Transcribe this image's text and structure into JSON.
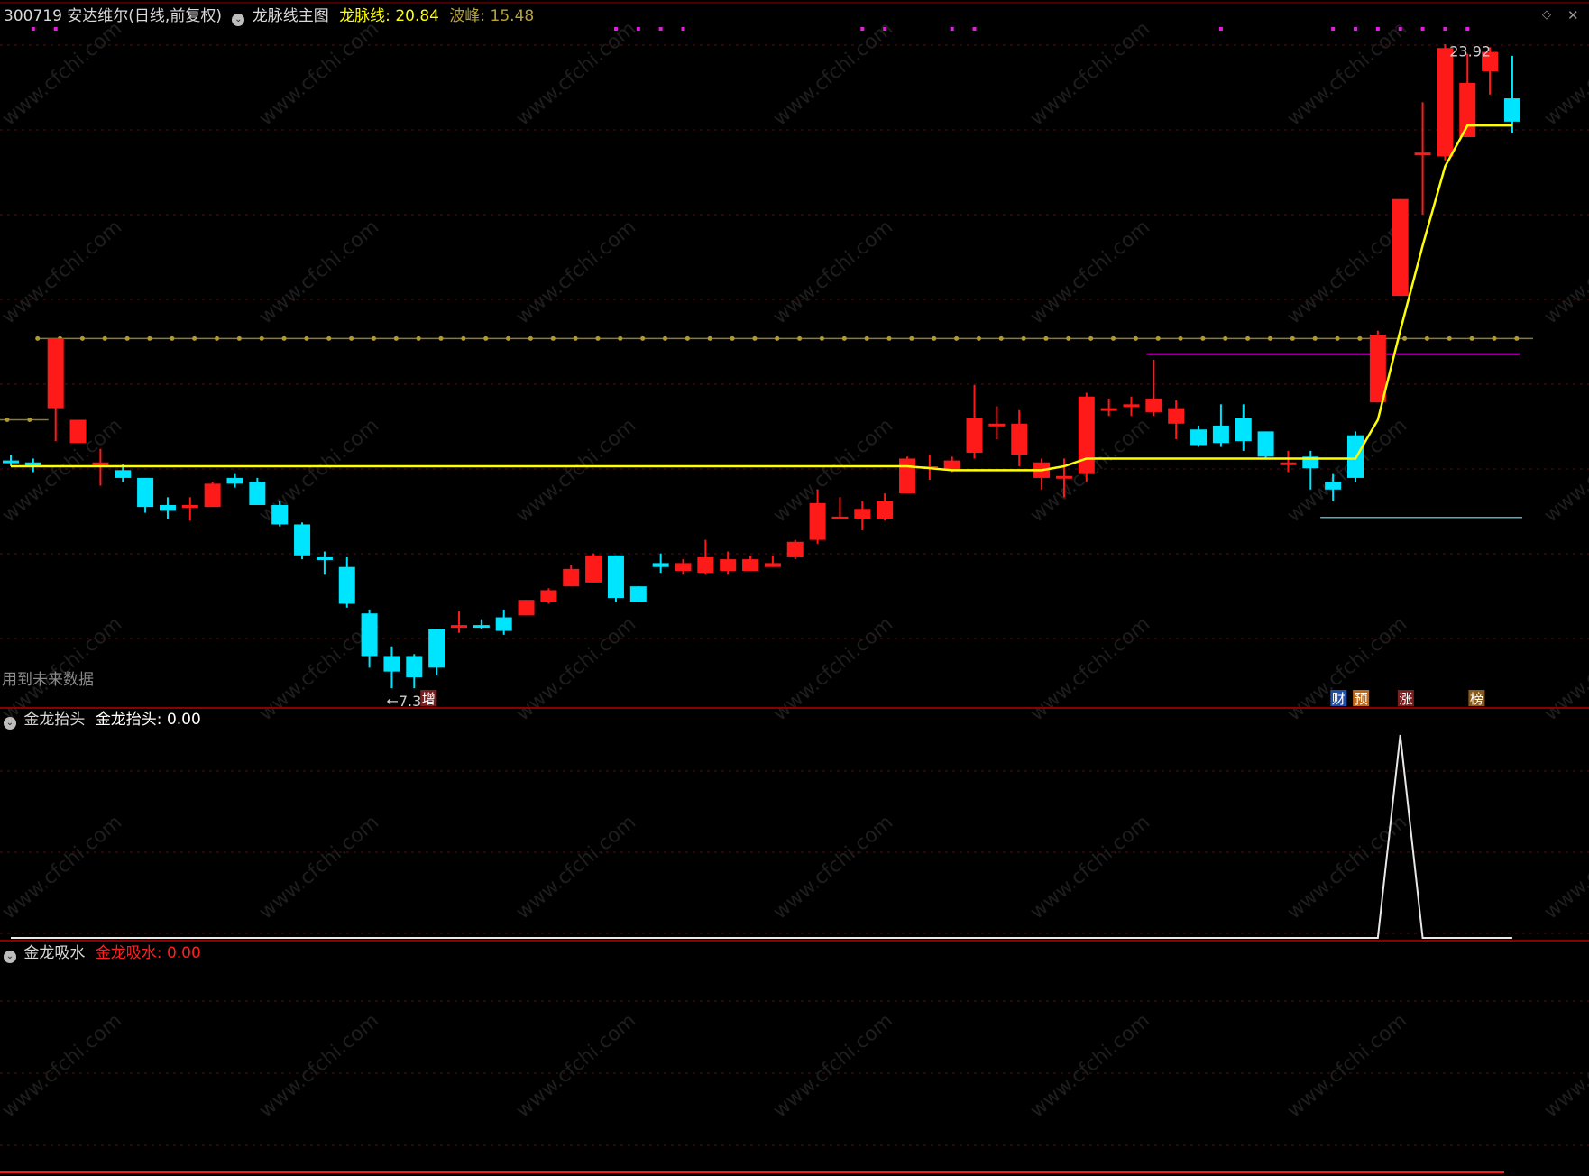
{
  "header": {
    "stock": "300719 安达维尔(日线,前复权)",
    "indicator_name": "龙脉线主图",
    "line_label": "龙脉线:",
    "line_value": "20.84",
    "peak_label": "波峰:",
    "peak_value": "15.48"
  },
  "notes": {
    "future_data": "用到未来数据",
    "low_label": "←7.37",
    "high_label": "23.92"
  },
  "badges": [
    {
      "text": "增",
      "bg": "#7a1f1f",
      "fg": "#ffffff"
    },
    {
      "text": "财",
      "bg": "#1f4fa8",
      "fg": "#ffffff"
    },
    {
      "text": "预",
      "bg": "#c06a1a",
      "fg": "#ffffff"
    },
    {
      "text": "涨",
      "bg": "#7a1f1f",
      "fg": "#ffffff"
    },
    {
      "text": "榜",
      "bg": "#8a5a1a",
      "fg": "#ffffff"
    }
  ],
  "panel2": {
    "title": "金龙抬头",
    "series_label": "金龙抬头:",
    "value": "0.00"
  },
  "panel3": {
    "title": "金龙吸水",
    "series_label": "金龙吸水:",
    "value": "0.00"
  },
  "colors": {
    "up": "#ff1a1a",
    "down": "#00e5ff",
    "dragon_line": "#ffff00",
    "dotted_line": "#8b7a2a",
    "magenta": "#ff00ff",
    "divider": "#8b0000",
    "watermark": "#1e1e1e"
  },
  "watermark": "www.cfchi.com",
  "chart_data": {
    "type": "candlestick",
    "ylim": [
      7.0,
      25.0
    ],
    "candles": [
      {
        "o": 13.25,
        "h": 13.4,
        "l": 13.1,
        "c": 13.2
      },
      {
        "o": 13.2,
        "h": 13.3,
        "l": 12.95,
        "c": 13.1
      },
      {
        "o": 14.6,
        "h": 16.4,
        "l": 13.75,
        "c": 16.4
      },
      {
        "o": 13.7,
        "h": 14.3,
        "l": 13.7,
        "c": 14.3
      },
      {
        "o": 13.2,
        "h": 13.55,
        "l": 12.6,
        "c": 13.2
      },
      {
        "o": 13.0,
        "h": 13.15,
        "l": 12.7,
        "c": 12.8
      },
      {
        "o": 12.8,
        "h": 12.8,
        "l": 11.9,
        "c": 12.05
      },
      {
        "o": 12.1,
        "h": 12.3,
        "l": 11.75,
        "c": 11.95
      },
      {
        "o": 12.1,
        "h": 12.3,
        "l": 11.7,
        "c": 12.1
      },
      {
        "o": 12.05,
        "h": 12.7,
        "l": 12.05,
        "c": 12.65
      },
      {
        "o": 12.8,
        "h": 12.9,
        "l": 12.55,
        "c": 12.65
      },
      {
        "o": 12.7,
        "h": 12.8,
        "l": 12.1,
        "c": 12.1
      },
      {
        "o": 12.1,
        "h": 12.2,
        "l": 11.55,
        "c": 11.6
      },
      {
        "o": 11.6,
        "h": 11.65,
        "l": 10.7,
        "c": 10.8
      },
      {
        "o": 10.75,
        "h": 10.9,
        "l": 10.3,
        "c": 10.7
      },
      {
        "o": 10.5,
        "h": 10.75,
        "l": 9.45,
        "c": 9.55
      },
      {
        "o": 9.3,
        "h": 9.4,
        "l": 7.9,
        "c": 8.2
      },
      {
        "o": 8.2,
        "h": 8.45,
        "l": 7.37,
        "c": 7.8
      },
      {
        "o": 8.2,
        "h": 8.25,
        "l": 7.37,
        "c": 7.65
      },
      {
        "o": 8.9,
        "h": 8.9,
        "l": 7.7,
        "c": 7.9
      },
      {
        "o": 9.0,
        "h": 9.35,
        "l": 8.8,
        "c": 9.0
      },
      {
        "o": 9.0,
        "h": 9.15,
        "l": 8.9,
        "c": 8.95
      },
      {
        "o": 9.2,
        "h": 9.4,
        "l": 8.75,
        "c": 8.85
      },
      {
        "o": 9.25,
        "h": 9.65,
        "l": 9.25,
        "c": 9.65
      },
      {
        "o": 9.6,
        "h": 9.95,
        "l": 9.55,
        "c": 9.9
      },
      {
        "o": 10.0,
        "h": 10.55,
        "l": 10.0,
        "c": 10.45
      },
      {
        "o": 10.1,
        "h": 10.85,
        "l": 10.1,
        "c": 10.8
      },
      {
        "o": 10.8,
        "h": 10.8,
        "l": 9.6,
        "c": 9.7
      },
      {
        "o": 10.0,
        "h": 10.0,
        "l": 9.6,
        "c": 9.6
      },
      {
        "o": 10.6,
        "h": 10.85,
        "l": 10.35,
        "c": 10.5
      },
      {
        "o": 10.4,
        "h": 10.7,
        "l": 10.3,
        "c": 10.6
      },
      {
        "o": 10.35,
        "h": 11.2,
        "l": 10.3,
        "c": 10.75
      },
      {
        "o": 10.4,
        "h": 10.9,
        "l": 10.3,
        "c": 10.7
      },
      {
        "o": 10.4,
        "h": 10.8,
        "l": 10.4,
        "c": 10.7
      },
      {
        "o": 10.5,
        "h": 10.8,
        "l": 10.5,
        "c": 10.6
      },
      {
        "o": 10.75,
        "h": 11.2,
        "l": 10.7,
        "c": 11.15
      },
      {
        "o": 11.2,
        "h": 12.5,
        "l": 11.1,
        "c": 12.15
      },
      {
        "o": 11.8,
        "h": 12.3,
        "l": 11.8,
        "c": 11.8
      },
      {
        "o": 11.75,
        "h": 12.2,
        "l": 11.45,
        "c": 12.0
      },
      {
        "o": 11.75,
        "h": 12.4,
        "l": 11.7,
        "c": 12.2
      },
      {
        "o": 12.4,
        "h": 13.35,
        "l": 12.4,
        "c": 13.3
      },
      {
        "o": 13.1,
        "h": 13.4,
        "l": 12.75,
        "c": 13.1
      },
      {
        "o": 13.0,
        "h": 13.35,
        "l": 12.95,
        "c": 13.25
      },
      {
        "o": 13.45,
        "h": 15.2,
        "l": 13.3,
        "c": 14.35
      },
      {
        "o": 14.2,
        "h": 14.65,
        "l": 13.8,
        "c": 14.2
      },
      {
        "o": 13.4,
        "h": 14.55,
        "l": 13.1,
        "c": 14.2
      },
      {
        "o": 12.8,
        "h": 13.3,
        "l": 12.5,
        "c": 13.2
      },
      {
        "o": 12.85,
        "h": 13.3,
        "l": 12.3,
        "c": 12.85
      },
      {
        "o": 12.9,
        "h": 15.0,
        "l": 12.7,
        "c": 14.9
      },
      {
        "o": 14.6,
        "h": 14.85,
        "l": 14.4,
        "c": 14.6
      },
      {
        "o": 14.7,
        "h": 14.9,
        "l": 14.4,
        "c": 14.7
      },
      {
        "o": 14.5,
        "h": 15.85,
        "l": 14.4,
        "c": 14.85
      },
      {
        "o": 14.2,
        "h": 14.8,
        "l": 13.8,
        "c": 14.6
      },
      {
        "o": 14.05,
        "h": 14.15,
        "l": 13.6,
        "c": 13.65
      },
      {
        "o": 14.15,
        "h": 14.7,
        "l": 13.6,
        "c": 13.7
      },
      {
        "o": 14.35,
        "h": 14.7,
        "l": 13.5,
        "c": 13.75
      },
      {
        "o": 14.0,
        "h": 14.0,
        "l": 13.3,
        "c": 13.35
      },
      {
        "o": 13.2,
        "h": 13.5,
        "l": 12.95,
        "c": 13.2
      },
      {
        "o": 13.35,
        "h": 13.5,
        "l": 12.5,
        "c": 13.05
      },
      {
        "o": 12.7,
        "h": 12.9,
        "l": 12.2,
        "c": 12.5
      },
      {
        "o": 13.9,
        "h": 14.0,
        "l": 12.7,
        "c": 12.8
      },
      {
        "o": 14.75,
        "h": 16.6,
        "l": 14.75,
        "c": 16.5
      },
      {
        "o": 17.5,
        "h": 20.0,
        "l": 17.5,
        "c": 20.0
      },
      {
        "o": 21.2,
        "h": 22.5,
        "l": 19.6,
        "c": 21.2
      },
      {
        "o": 21.1,
        "h": 24.0,
        "l": 21.0,
        "c": 23.9
      },
      {
        "o": 21.6,
        "h": 23.75,
        "l": 21.6,
        "c": 23.0
      },
      {
        "o": 23.3,
        "h": 23.92,
        "l": 22.7,
        "c": 23.8
      },
      {
        "o": 22.6,
        "h": 23.7,
        "l": 21.7,
        "c": 22.0
      }
    ],
    "dragon_line": [
      [
        0,
        13.1
      ],
      [
        1,
        13.1
      ],
      [
        2,
        13.1
      ],
      [
        3,
        13.1
      ],
      [
        4,
        13.1
      ],
      [
        5,
        13.1
      ],
      [
        6,
        13.1
      ],
      [
        7,
        13.1
      ],
      [
        8,
        13.1
      ],
      [
        9,
        13.1
      ],
      [
        10,
        13.1
      ],
      [
        11,
        13.1
      ],
      [
        12,
        13.1
      ],
      [
        13,
        13.1
      ],
      [
        14,
        13.1
      ],
      [
        15,
        13.1
      ],
      [
        16,
        13.1
      ],
      [
        17,
        13.1
      ],
      [
        18,
        13.1
      ],
      [
        19,
        13.1
      ],
      [
        20,
        13.1
      ],
      [
        21,
        13.1
      ],
      [
        22,
        13.1
      ],
      [
        23,
        13.1
      ],
      [
        24,
        13.1
      ],
      [
        25,
        13.1
      ],
      [
        26,
        13.1
      ],
      [
        27,
        13.1
      ],
      [
        28,
        13.1
      ],
      [
        29,
        13.1
      ],
      [
        30,
        13.1
      ],
      [
        31,
        13.1
      ],
      [
        32,
        13.1
      ],
      [
        33,
        13.1
      ],
      [
        34,
        13.1
      ],
      [
        35,
        13.1
      ],
      [
        36,
        13.1
      ],
      [
        37,
        13.1
      ],
      [
        38,
        13.1
      ],
      [
        39,
        13.1
      ],
      [
        40,
        13.1
      ],
      [
        41,
        13.05
      ],
      [
        42,
        13.0
      ],
      [
        43,
        13.0
      ],
      [
        44,
        13.0
      ],
      [
        45,
        13.0
      ],
      [
        46,
        13.0
      ],
      [
        47,
        13.1
      ],
      [
        48,
        13.3
      ],
      [
        49,
        13.3
      ],
      [
        50,
        13.3
      ],
      [
        51,
        13.3
      ],
      [
        52,
        13.3
      ],
      [
        53,
        13.3
      ],
      [
        54,
        13.3
      ],
      [
        55,
        13.3
      ],
      [
        56,
        13.3
      ],
      [
        57,
        13.3
      ],
      [
        58,
        13.3
      ],
      [
        59,
        13.3
      ],
      [
        60,
        13.3
      ],
      [
        61,
        14.3
      ],
      [
        62,
        16.6
      ],
      [
        63,
        18.8
      ],
      [
        64,
        20.84
      ],
      [
        65,
        21.9
      ],
      [
        66,
        21.9
      ],
      [
        67,
        21.9
      ]
    ],
    "dotted_line": 16.4,
    "dotted_line_start": 2,
    "left_stub_line": 14.3,
    "magenta_level": 16.0,
    "magenta_from": 51,
    "cyan_level": 12.2,
    "cyan_from": 59,
    "markers_top": [
      1,
      2,
      27,
      28,
      29,
      30,
      38,
      39,
      42,
      43,
      54,
      59,
      60,
      61,
      62,
      63,
      64,
      65
    ]
  },
  "jlt_chart": {
    "type": "line",
    "ylim": [
      0,
      1
    ],
    "values": [
      0,
      0,
      0,
      0,
      0,
      0,
      0,
      0,
      0,
      0,
      0,
      0,
      0,
      0,
      0,
      0,
      0,
      0,
      0,
      0,
      0,
      0,
      0,
      0,
      0,
      0,
      0,
      0,
      0,
      0,
      0,
      0,
      0,
      0,
      0,
      0,
      0,
      0,
      0,
      0,
      0,
      0,
      0,
      0,
      0,
      0,
      0,
      0,
      0,
      0,
      0,
      0,
      0,
      0,
      0,
      0,
      0,
      0,
      0,
      0,
      0,
      0,
      1,
      0,
      0,
      0,
      0,
      0
    ]
  }
}
